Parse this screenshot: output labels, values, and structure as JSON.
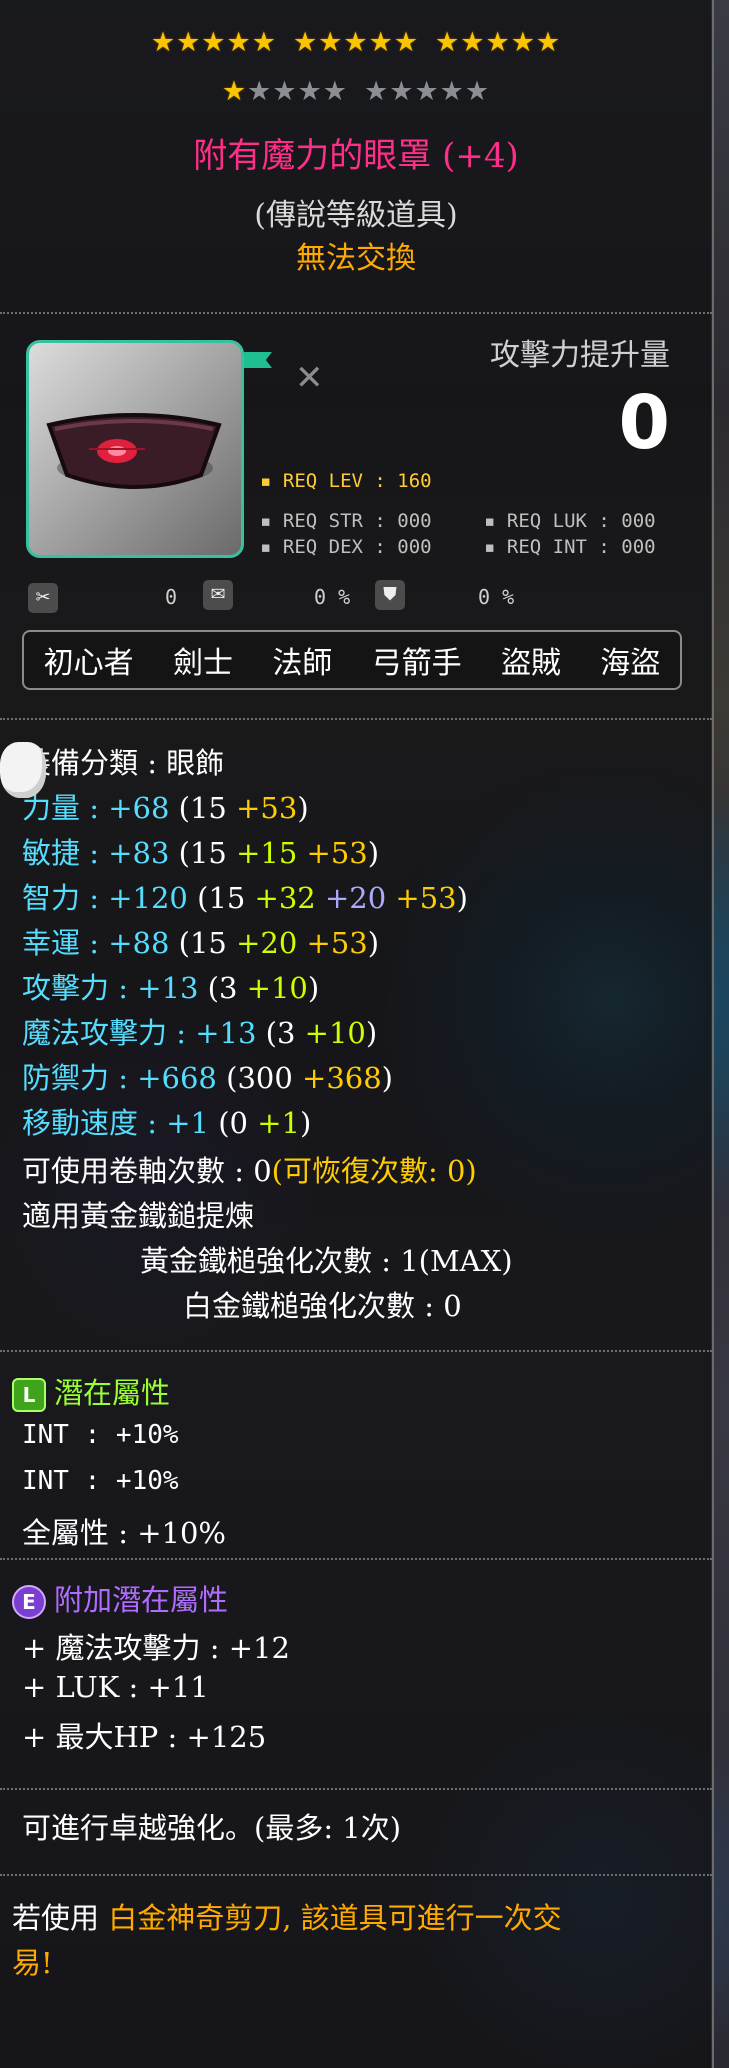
{
  "stars": {
    "filled": 16,
    "total": 30,
    "per_group": 5
  },
  "item": {
    "name": "附有魔力的眼罩 (+4)",
    "grade": "(傳說等級道具)",
    "trade_status": "無法交換"
  },
  "attack_boost": {
    "label": "攻擊力提升量",
    "value": "0"
  },
  "requirements": {
    "lev": "▪ REQ LEV : 160",
    "str": "▪ REQ STR : 000",
    "luk": "▪ REQ LUK : 000",
    "dex": "▪ REQ DEX : 000",
    "int": "▪ REQ INT : 000"
  },
  "slots": {
    "a": "0",
    "b": "0 %",
    "c": "0 %"
  },
  "jobs": [
    "初心者",
    "劍士",
    "法師",
    "弓箭手",
    "盜賊",
    "海盜"
  ],
  "equip_type": {
    "label": "裝備分類",
    "sep": " : ",
    "value": "眼飾"
  },
  "stats": [
    {
      "label": "力量",
      "total": "+68",
      "open": "(",
      "base": "15",
      "add1": "",
      "add2": "",
      "star": " +53",
      "close": ")"
    },
    {
      "label": "敏捷",
      "total": "+83",
      "open": "(",
      "base": "15",
      "add1": " +15",
      "add2": "",
      "star": " +53",
      "close": ")"
    },
    {
      "label": "智力",
      "total": "+120",
      "open": "(",
      "base": "15",
      "add1": " +32",
      "add2": " +20",
      "star": " +53",
      "close": ")"
    },
    {
      "label": "幸運",
      "total": "+88",
      "open": "(",
      "base": "15",
      "add1": " +20",
      "add2": "",
      "star": " +53",
      "close": ")"
    },
    {
      "label": "攻擊力",
      "total": "+13",
      "open": "(",
      "base": "3",
      "add1": " +10",
      "add2": "",
      "star": "",
      "close": ")"
    },
    {
      "label": "魔法攻擊力",
      "total": "+13",
      "open": "(",
      "base": "3",
      "add1": " +10",
      "add2": "",
      "star": "",
      "close": ")"
    },
    {
      "label": "防禦力",
      "total": "+668",
      "open": "(",
      "base": "300",
      "add1": "",
      "add2": "",
      "star": " +368",
      "close": ")"
    },
    {
      "label": "移動速度",
      "total": "+1",
      "open": "(",
      "base": "0",
      "add1": " +1",
      "add2": "",
      "star": "",
      "close": ")"
    }
  ],
  "scroll": {
    "text": "可使用卷軸次數 : 0",
    "recover": "(可恢復次數: 0)"
  },
  "hammer": {
    "applied": "適用黃金鐵鎚提煉",
    "gold_count": "黃金鐵槌強化次數 : 1(MAX)",
    "plat_count": "白金鐵槌強化次數 : 0"
  },
  "potential": {
    "badge": "L",
    "title": "潛在屬性",
    "lines": [
      "INT : +10%",
      "INT : +10%",
      "全屬性 : +10%"
    ]
  },
  "bonus_potential": {
    "badge": "E",
    "title": "附加潛在屬性",
    "lines": [
      "+ 魔法攻擊力 : +12",
      "+ LUK : +11",
      "+ 最大HP : +125"
    ]
  },
  "transcend": "可進行卓越強化。(最多: 1次)",
  "scissors": {
    "prefix": "若使用 ",
    "name": "白金神奇剪刀",
    "suffix": ", 該道具可進行一次交",
    "wrap": "易!"
  },
  "colors": {
    "title": "#ff2e88",
    "gold": "#ffaa00",
    "cyan": "#55ddff",
    "lime": "#ccff00",
    "border": "#36c2a1"
  }
}
